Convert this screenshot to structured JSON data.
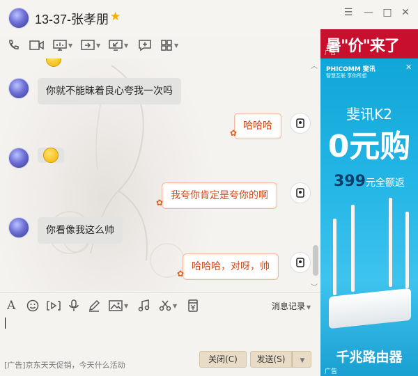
{
  "window": {
    "title": "13-37-张孝朋"
  },
  "messages": [
    {
      "direction": "in",
      "text": "你就不能昧着良心夸我一次吗"
    },
    {
      "direction": "out",
      "text": "哈哈哈"
    },
    {
      "direction": "in",
      "type": "emoji",
      "text": ""
    },
    {
      "direction": "out",
      "text": "我夸你肯定是夸你的啊"
    },
    {
      "direction": "in",
      "text": "你看像我这么帅"
    },
    {
      "direction": "out",
      "text": "哈哈哈，对呀，帅"
    }
  ],
  "input_toolbar": {
    "history_label": "消息记录"
  },
  "footer": {
    "ad_text": "[广告]京东天天促销，今天什么活动",
    "close_button": "关闭(C)",
    "send_button": "发送(S)"
  },
  "ad": {
    "top_banner_text": "暑\"价\"来了",
    "top_banner_small": "广告",
    "brand": "PHICOMM 斐讯",
    "slogan": "智慧互联 享你所想",
    "product": "斐讯K2",
    "promo": "0元购",
    "promo_sub_number": "399",
    "promo_sub_text": "元全额返",
    "product_title": "千兆路由器",
    "ad_label": "广告",
    "colors": {
      "banner": "#c8102e",
      "panel": "#24b6e6"
    }
  }
}
